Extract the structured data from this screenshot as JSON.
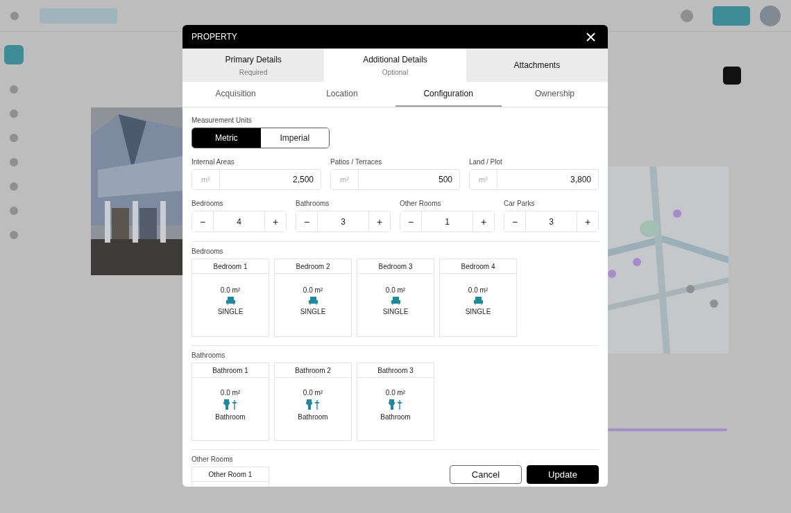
{
  "dialog": {
    "title": "PROPERTY"
  },
  "steps": [
    {
      "label": "Primary Details",
      "sublabel": "Required",
      "selected": false
    },
    {
      "label": "Additional Details",
      "sublabel": "Optional",
      "selected": true
    },
    {
      "label": "Attachments",
      "selected": false
    }
  ],
  "subtabs": [
    {
      "label": "Acquisition",
      "selected": false
    },
    {
      "label": "Location",
      "selected": false
    },
    {
      "label": "Configuration",
      "selected": true
    },
    {
      "label": "Ownership",
      "selected": false
    }
  ],
  "measurement": {
    "label": "Measurement Units",
    "options": [
      {
        "label": "Metric",
        "selected": true
      },
      {
        "label": "Imperial",
        "selected": false
      }
    ]
  },
  "areas": [
    {
      "label": "Internal Areas",
      "unit": "m²",
      "value": "2,500"
    },
    {
      "label": "Patios / Terraces",
      "unit": "m²",
      "value": "500"
    },
    {
      "label": "Land / Plot",
      "unit": "m²",
      "value": "3,800"
    }
  ],
  "counters": [
    {
      "label": "Bedrooms",
      "minus": "−",
      "value": "4",
      "plus": "+"
    },
    {
      "label": "Bathrooms",
      "minus": "−",
      "value": "3",
      "plus": "+"
    },
    {
      "label": "Other Rooms",
      "minus": "−",
      "value": "1",
      "plus": "+"
    },
    {
      "label": "Car Parks",
      "minus": "−",
      "value": "3",
      "plus": "+"
    }
  ],
  "sections": [
    {
      "title": "Bedrooms",
      "rooms": [
        {
          "name": "Bedroom 1",
          "area": "0.0 m²",
          "kind": "bed",
          "type": "SINGLE"
        },
        {
          "name": "Bedroom 2",
          "area": "0.0 m²",
          "kind": "bed",
          "type": "SINGLE"
        },
        {
          "name": "Bedroom 3",
          "area": "0.0 m²",
          "kind": "bed",
          "type": "SINGLE"
        },
        {
          "name": "Bedroom 4",
          "area": "0.0 m²",
          "kind": "bed",
          "type": "SINGLE"
        }
      ]
    },
    {
      "title": "Bathrooms",
      "rooms": [
        {
          "name": "Bathroom 1",
          "area": "0.0 m²",
          "kind": "bath",
          "type": "Bathroom"
        },
        {
          "name": "Bathroom 2",
          "area": "0.0 m²",
          "kind": "bath",
          "type": "Bathroom"
        },
        {
          "name": "Bathroom 3",
          "area": "0.0 m²",
          "kind": "bath",
          "type": "Bathroom"
        }
      ]
    },
    {
      "title": "Other Rooms",
      "rooms": [
        {
          "name": "Other Room 1",
          "kind": "other"
        }
      ]
    }
  ],
  "buttons": [
    {
      "label": "Cancel",
      "kind": "secondary"
    },
    {
      "label": "Update",
      "kind": "primary"
    }
  ]
}
